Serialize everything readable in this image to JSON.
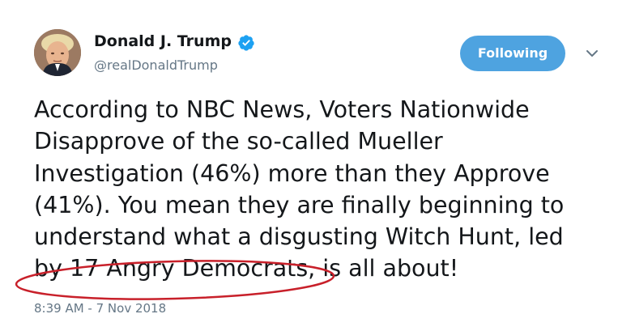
{
  "author": {
    "name": "Donald J. Trump",
    "handle": "@realDonaldTrump",
    "verified": true,
    "avatar": "profile-photo"
  },
  "follow_button": {
    "label": "Following",
    "color": "#4ea3e0"
  },
  "menu_icon": "chevron-down-icon",
  "tweet": {
    "lines": [
      "According to NBC News, Voters Nationwide",
      "Disapprove of the so-called Mueller",
      "Investigation (46%) more than they Approve",
      "(41%). You mean they are finally beginning to",
      "understand what a disgusting Witch Hunt, led",
      "by 17 Angry Democrats, is all about!"
    ],
    "annotation_color": "#c8202a"
  },
  "timestamp": "8:39 AM - 7 Nov 2018",
  "colors": {
    "text": "#14171a",
    "secondary": "#657786",
    "verified_badge": "#1da1f2"
  }
}
